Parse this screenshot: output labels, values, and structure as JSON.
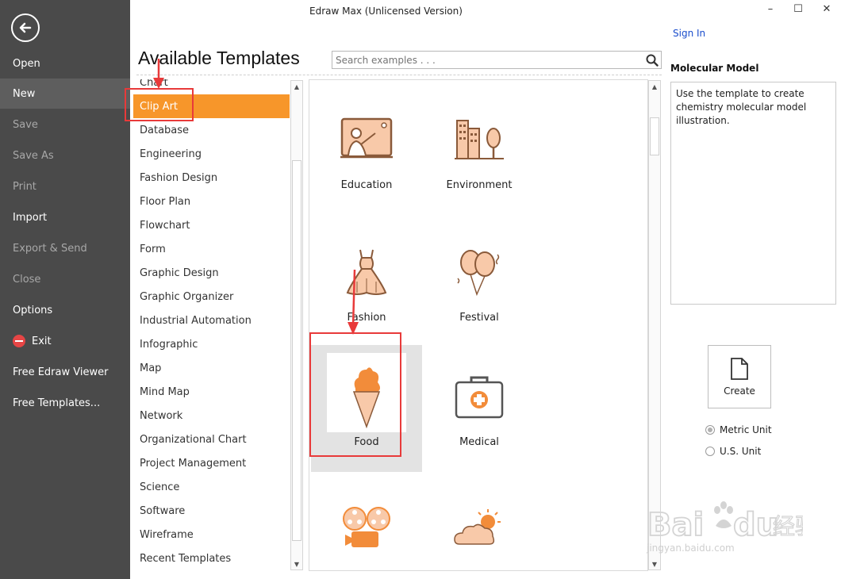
{
  "window": {
    "title": "Edraw Max (Unlicensed Version)",
    "sign_in": "Sign In",
    "controls": {
      "minimize": "–",
      "maximize": "☐",
      "close": "✕"
    }
  },
  "sidebar": {
    "items": [
      {
        "label": "Open",
        "state": "normal"
      },
      {
        "label": "New",
        "state": "active"
      },
      {
        "label": "Save",
        "state": "dim"
      },
      {
        "label": "Save As",
        "state": "dim"
      },
      {
        "label": "Print",
        "state": "dim"
      },
      {
        "label": "Import",
        "state": "normal"
      },
      {
        "label": "Export & Send",
        "state": "dim"
      },
      {
        "label": "Close",
        "state": "dim"
      },
      {
        "label": "Options",
        "state": "normal"
      },
      {
        "label": "Exit",
        "state": "normal"
      },
      {
        "label": "Free Edraw Viewer",
        "state": "normal"
      },
      {
        "label": "Free Templates...",
        "state": "normal"
      }
    ]
  },
  "main": {
    "heading": "Available Templates",
    "search_placeholder": "Search examples . . ."
  },
  "categories": [
    "Chart",
    "Clip Art",
    "Database",
    "Engineering",
    "Fashion Design",
    "Floor Plan",
    "Flowchart",
    "Form",
    "Graphic Design",
    "Graphic Organizer",
    "Industrial Automation",
    "Infographic",
    "Map",
    "Mind Map",
    "Network",
    "Organizational Chart",
    "Project Management",
    "Science",
    "Software",
    "Wireframe",
    "Recent Templates"
  ],
  "selected_category": "Clip Art",
  "templates": [
    {
      "label": "Education",
      "icon": "education-icon"
    },
    {
      "label": "Environment",
      "icon": "environment-icon"
    },
    {
      "label": "Fashion",
      "icon": "dress-icon"
    },
    {
      "label": "Festival",
      "icon": "balloons-icon"
    },
    {
      "label": "Food",
      "icon": "ice-cream-icon",
      "selected": true
    },
    {
      "label": "Medical",
      "icon": "medical-kit-icon"
    },
    {
      "label": "",
      "icon": "film-camera-icon"
    },
    {
      "label": "",
      "icon": "weather-icon"
    }
  ],
  "details": {
    "title": "Molecular Model",
    "description": "Use the template to create chemistry molecular model illustration.",
    "create_label": "Create",
    "units": [
      {
        "label": "Metric Unit",
        "checked": true
      },
      {
        "label": "U.S. Unit",
        "checked": false
      }
    ]
  },
  "watermark": {
    "brand": "Bai du 经验",
    "url": "jingyan.baidu.com"
  },
  "colors": {
    "accent": "#f7962a",
    "sidebar": "#4a4a4a",
    "annotation": "#e83a3a",
    "icon_fill": "#f8c9a9",
    "icon_stroke": "#b06a3a"
  }
}
